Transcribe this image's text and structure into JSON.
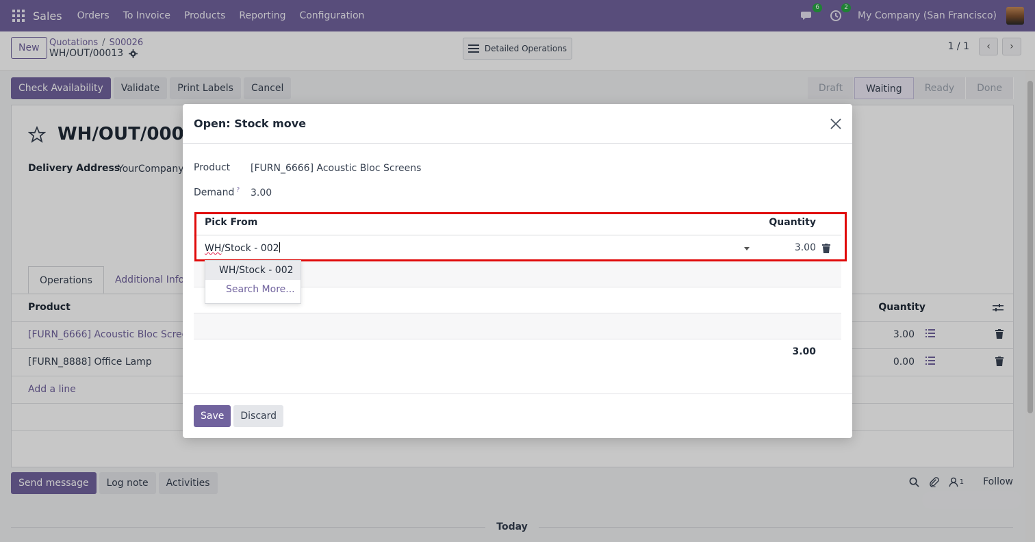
{
  "navbar": {
    "app_name": "Sales",
    "menu": [
      "Orders",
      "To Invoice",
      "Products",
      "Reporting",
      "Configuration"
    ],
    "messages_count": "6",
    "activities_count": "2",
    "company": "My Company (San Francisco)"
  },
  "control": {
    "new_label": "New",
    "breadcrumb": [
      "Quotations",
      "S00026"
    ],
    "record_name": "WH/OUT/00013",
    "detailed_ops_label": "Detailed Operations",
    "pager": "1 / 1"
  },
  "actions": [
    "Check Availability",
    "Validate",
    "Print Labels",
    "Cancel"
  ],
  "status_stages": [
    "Draft",
    "Waiting",
    "Ready",
    "Done"
  ],
  "status_active": "Waiting",
  "form": {
    "title": "WH/OUT/0001",
    "delivery_label": "Delivery Address",
    "delivery_value": "YourCompany,",
    "tabs": [
      "Operations",
      "Additional Info"
    ],
    "table_headers": {
      "product": "Product",
      "quantity": "Quantity"
    },
    "rows": [
      {
        "product": "[FURN_6666] Acoustic Bloc Screens",
        "quantity": "3.00"
      },
      {
        "product": "[FURN_8888] Office Lamp",
        "quantity": "0.00"
      }
    ],
    "add_line": "Add a line"
  },
  "chatter": {
    "buttons": [
      "Send message",
      "Log note",
      "Activities"
    ],
    "followers_count": "1",
    "follow_label": "Follow",
    "today_label": "Today"
  },
  "modal": {
    "title": "Open: Stock move",
    "product_label": "Product",
    "product_value": "[FURN_6666] Acoustic Bloc Screens",
    "demand_label": "Demand",
    "demand_help": "?",
    "demand_value": "3.00",
    "pick_from_header": "Pick From",
    "quantity_header": "Quantity",
    "pick_prefix": "WH",
    "pick_rest": "/Stock - 002",
    "pick_qty": "3.00",
    "total": "3.00",
    "dropdown": [
      "WH/Stock - 002",
      "Search More..."
    ],
    "save_label": "Save",
    "discard_label": "Discard"
  },
  "colors": {
    "brand": "#71639e",
    "highlight": "#e00a0a"
  }
}
